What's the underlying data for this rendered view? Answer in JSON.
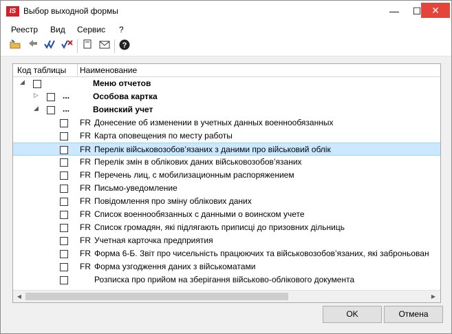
{
  "window": {
    "title": "Выбор выходной формы",
    "logo_text": "IS",
    "min_glyph": "—",
    "max_glyph": "☐",
    "close_glyph": "✕"
  },
  "menu": [
    "Реестр",
    "Вид",
    "Сервис",
    "?"
  ],
  "toolbar": {
    "icons": [
      "open-folder-icon",
      "arrow-icon",
      "check-all-icon",
      "uncheck-all-icon",
      "document-icon",
      "envelope-icon",
      "help-icon"
    ]
  },
  "table": {
    "columns": [
      "Код таблицы",
      "Наименование"
    ],
    "rows": [
      {
        "level": 0,
        "expander": "◢",
        "dots": "",
        "code": "",
        "name": "Меню отчетов",
        "bold": true
      },
      {
        "level": 1,
        "expander": "▷",
        "dots": "...",
        "code": "",
        "name": "Особова картка",
        "bold": true
      },
      {
        "level": 1,
        "expander": "◢",
        "dots": "...",
        "code": "",
        "name": "Воинский учет",
        "bold": true
      },
      {
        "level": 2,
        "expander": "",
        "dots": "",
        "code": "FR",
        "name": "Донесение об изменении в учетных данных военнообязанных",
        "bold": false
      },
      {
        "level": 2,
        "expander": "",
        "dots": "",
        "code": "FR",
        "name": "Карта оповещения по месту работы",
        "bold": false
      },
      {
        "level": 2,
        "expander": "",
        "dots": "",
        "code": "FR",
        "name": "Перелік військовозобов’язаних з даними про військовий облік",
        "bold": false,
        "selected": true
      },
      {
        "level": 2,
        "expander": "",
        "dots": "",
        "code": "FR",
        "name": "Перелік змін в облікових даних військовозобов’язаних",
        "bold": false
      },
      {
        "level": 2,
        "expander": "",
        "dots": "",
        "code": "FR",
        "name": "Перечень лиц, с мобилизационным распоряжением",
        "bold": false
      },
      {
        "level": 2,
        "expander": "",
        "dots": "",
        "code": "FR",
        "name": "Письмо-уведомление",
        "bold": false
      },
      {
        "level": 2,
        "expander": "",
        "dots": "",
        "code": "FR",
        "name": "Повідомлення про зміну облікових даних",
        "bold": false
      },
      {
        "level": 2,
        "expander": "",
        "dots": "",
        "code": "FR",
        "name": "Список военнообязанных с данными о воинском учете",
        "bold": false
      },
      {
        "level": 2,
        "expander": "",
        "dots": "",
        "code": "FR",
        "name": "Список громадян, які підлягають приписці до призовних дільниць",
        "bold": false
      },
      {
        "level": 2,
        "expander": "",
        "dots": "",
        "code": "FR",
        "name": "Учетная карточка предприятия",
        "bold": false
      },
      {
        "level": 2,
        "expander": "",
        "dots": "",
        "code": "FR",
        "name": "Форма 6-Б. Звіт про чисельність працюючих та військовозобов’язаних, які заброньован",
        "bold": false
      },
      {
        "level": 2,
        "expander": "",
        "dots": "",
        "code": "FR",
        "name": "Форма узгодження даних з військоматами",
        "bold": false
      },
      {
        "level": 2,
        "expander": "",
        "dots": "",
        "code": "",
        "name": "Розписка про прийом на зберігання військово-облікового документа",
        "bold": false
      }
    ]
  },
  "scrollbar": {
    "left_glyph": "◀",
    "right_glyph": "▶"
  },
  "buttons": {
    "ok": "OK",
    "cancel": "Отмена"
  }
}
